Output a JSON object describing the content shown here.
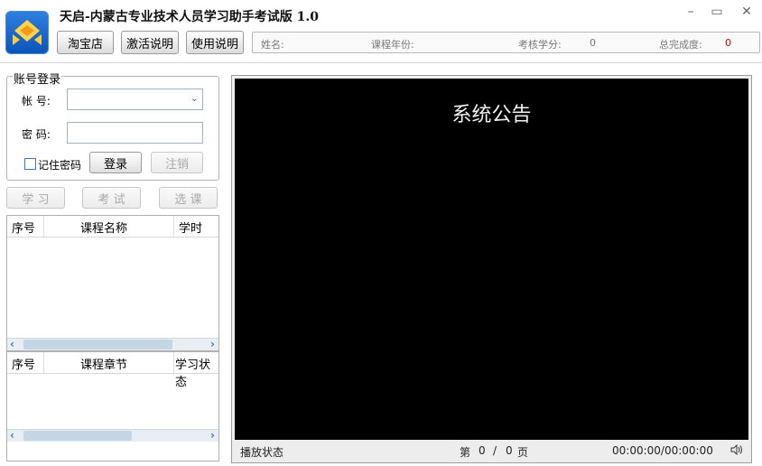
{
  "window": {
    "title": "天启-内蒙古专业技术人员学习助手考试版 1.0",
    "controls": [
      "–",
      "▭",
      "✕"
    ]
  },
  "toolbar": {
    "taobao": "淘宝店",
    "activation": "激活说明",
    "usage": "使用说明"
  },
  "info": {
    "name_label": "姓名:",
    "year_label": "课程年份:",
    "credit_label": "考核学分:",
    "credit_value": "0",
    "progress_label": "总完成度:",
    "progress_value": "0",
    "progress_color": "#d00000"
  },
  "login": {
    "legend": "账号登录",
    "account_label": "帐  号:",
    "password_label": "密  码:",
    "account_value": "",
    "password_value": "",
    "remember_label": "记住密码",
    "login_button": "登录",
    "logout_button": "注销"
  },
  "actions": {
    "study": "学 习",
    "exam": "考 试",
    "select": "选 课"
  },
  "course_list": {
    "columns": [
      "序号",
      "课程名称",
      "学时"
    ],
    "rows": []
  },
  "chapter_list": {
    "columns": [
      "序号",
      "课程章节",
      "学习状态"
    ],
    "rows": []
  },
  "player": {
    "notice_title": "系统公告",
    "status_label": "播放状态",
    "page_prefix": "第",
    "page_current": "0",
    "page_sep": "/",
    "page_total": "0",
    "page_suffix": "页",
    "time": "00:00:00/00:00:00",
    "volume_icon": "speaker-icon"
  }
}
